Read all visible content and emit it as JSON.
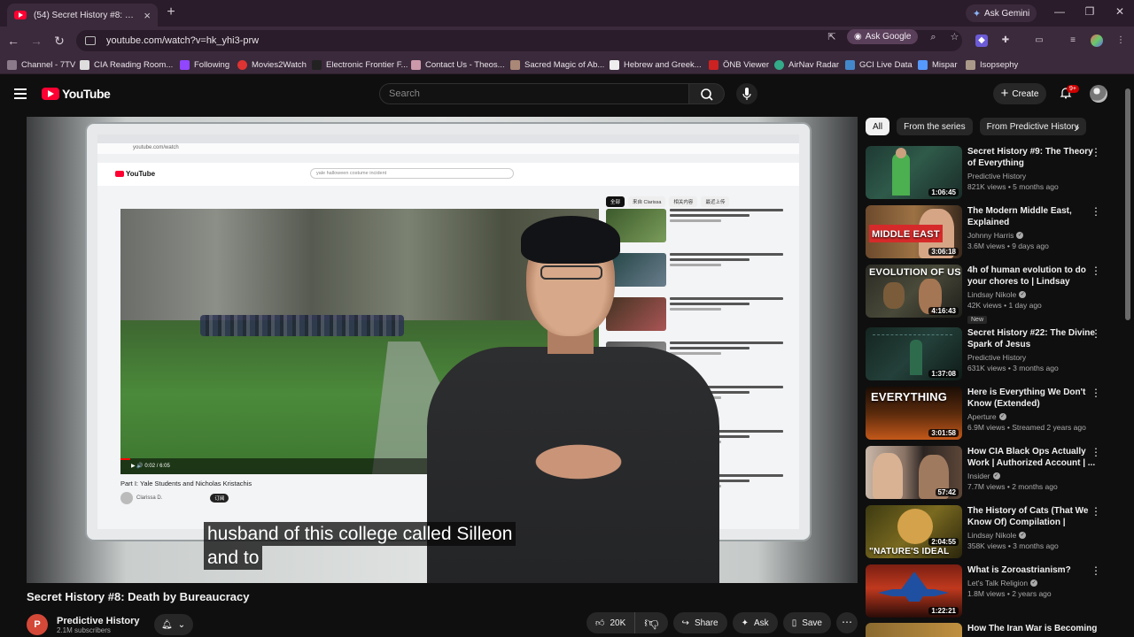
{
  "browser": {
    "tab_title": "(54) Secret History #8: Death by",
    "new_tab": "+",
    "ask_gemini": "Ask Gemini",
    "url": "youtube.com/watch?v=hk_yhi3-prw",
    "ask_google": "Ask Google",
    "bookmarks": [
      "Channel - 7TV",
      "CIA Reading Room...",
      "Following",
      "Movies2Watch",
      "Electronic Frontier F...",
      "Contact Us - Theos...",
      "Sacred Magic of Ab...",
      "Hebrew and Greek...",
      "ÖNB Viewer",
      "AirNav Radar",
      "GCI Live Data",
      "Mispar",
      "Isopsephy"
    ]
  },
  "youtube": {
    "logo": "YouTube",
    "search_placeholder": "Search",
    "create": "Create",
    "notifications": "9+"
  },
  "video": {
    "subtitle_line1": "husband of this college called Silleon",
    "subtitle_line2": "and to",
    "title": "Secret History #8: Death by Bureaucracy",
    "channel": "Predictive History",
    "channel_initial": "P",
    "subscribers": "2.1M subscribers",
    "likes": "20K",
    "share": "Share",
    "ask": "Ask",
    "save": "Save"
  },
  "sidebar": {
    "chips": [
      "All",
      "From the series",
      "From Predictive History"
    ],
    "items": [
      {
        "title": "Secret History #9:  The Theory of Everything",
        "channel": "Predictive History",
        "verified": false,
        "meta": "821K views • 5 months ago",
        "duration": "1:06:45",
        "thumb_text": "",
        "is_new": false
      },
      {
        "title": "The Modern Middle East, Explained",
        "channel": "Johnny Harris",
        "verified": true,
        "meta": "3.6M views • 9 days ago",
        "duration": "3:06:18",
        "thumb_text": "MIDDLE EAST",
        "is_new": false
      },
      {
        "title": "4h of human evolution to do your chores to | Lindsay Nikole",
        "channel": "Lindsay Nikole",
        "verified": true,
        "meta": "42K views • 1 day ago",
        "duration": "4:16:43",
        "thumb_text": "EVOLUTION OF US",
        "is_new": true,
        "new_label": "New"
      },
      {
        "title": "Secret History #22: The Divine Spark of Jesus",
        "channel": "Predictive History",
        "verified": false,
        "meta": "631K views • 3 months ago",
        "duration": "1:37:08",
        "thumb_text": "",
        "is_new": false
      },
      {
        "title": "Here is Everything We Don't Know (Extended)",
        "channel": "Aperture",
        "verified": true,
        "meta": "6.9M views • Streamed 2 years ago",
        "duration": "3:01:58",
        "thumb_text": "EVERYTHING",
        "is_new": false
      },
      {
        "title": "How CIA Black Ops Actually Work | Authorized Account | ...",
        "channel": "Insider",
        "verified": true,
        "meta": "7.7M views • 2 months ago",
        "duration": "57:42",
        "thumb_text": "",
        "is_new": false
      },
      {
        "title": "The History of Cats (That We Know Of) Compilation | Lindsa...",
        "channel": "Lindsay Nikole",
        "verified": true,
        "meta": "358K views • 3 months ago",
        "duration": "2:04:55",
        "thumb_text": "\"NATURE'S IDEAL",
        "is_new": false
      },
      {
        "title": "What is Zoroastrianism?",
        "channel": "Let's Talk Religion",
        "verified": true,
        "meta": "1.8M views • 2 years ago",
        "duration": "1:22:21",
        "thumb_text": "",
        "is_new": false
      },
      {
        "title": "How The Iran War is Becoming",
        "channel": "",
        "verified": false,
        "meta": "",
        "duration": "",
        "thumb_text": "",
        "is_new": false
      }
    ]
  },
  "colors": {
    "youtube_red": "#ff0033",
    "page_bg": "#0f0f0f",
    "chrome_bg": "#3b2a3b"
  }
}
